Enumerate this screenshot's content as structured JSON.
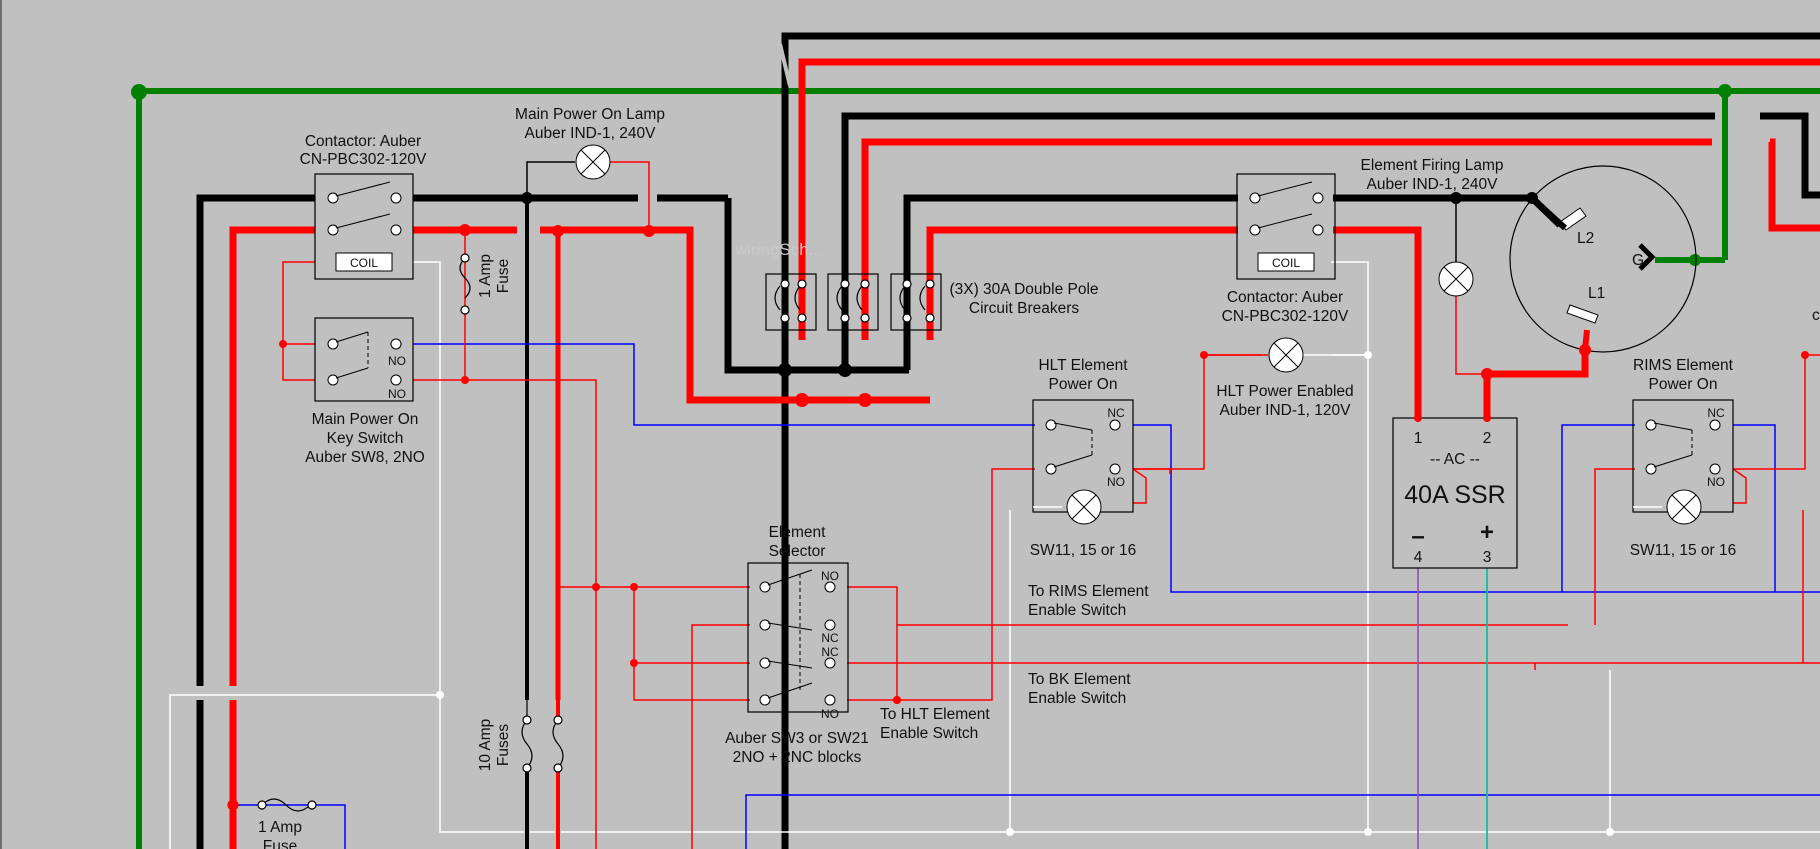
{
  "diagram": {
    "colors": {
      "background": "#c0c0c0",
      "line1": "#000000",
      "line2": "#ff0000",
      "ground": "#008000",
      "signal_blue": "#0000ff",
      "signal_red": "#ff0000",
      "neutral_white": "#ffffff",
      "ssr_dc_minus": "#9b59b6",
      "ssr_dc_plus": "#1abc9c"
    },
    "watermark": "wiringSch...",
    "labels": {
      "contactor1": [
        "Contactor:  Auber",
        "CN-PBC302-120V"
      ],
      "main_lamp": [
        "Main Power On Lamp",
        "Auber IND-1, 240V"
      ],
      "key_switch": [
        "Main Power On",
        "Key Switch",
        "Auber SW8, 2NO"
      ],
      "fuse_1amp_top": [
        "1 Amp",
        "Fuse"
      ],
      "breakers": [
        "(3X) 30A Double Pole",
        "Circuit Breakers"
      ],
      "firing_lamp": [
        "Element Firing Lamp",
        "Auber IND-1, 240V"
      ],
      "contactor2": [
        "Contactor:  Auber",
        "CN-PBC302-120V"
      ],
      "hlt_power_enabled": [
        "HLT Power Enabled",
        "Auber IND-1, 120V"
      ],
      "hlt_element": [
        "HLT Element",
        "Power On"
      ],
      "sw_hlt": "SW11, 15 or 16",
      "rims_element": [
        "RIMS Element",
        "Power On"
      ],
      "sw_rims": "SW11, 15 or 16",
      "ssr": {
        "pin1": "1",
        "pin2": "2",
        "ac": "-- AC --",
        "title": "40A SSR",
        "minus": "–",
        "plus": "+",
        "pin4": "4",
        "pin3": "3"
      },
      "to_rims": [
        "To RIMS Element",
        "Enable Switch"
      ],
      "to_bk": [
        "To BK Element",
        "Enable Switch"
      ],
      "element_selector": [
        "Element",
        "Selector"
      ],
      "selector_model": [
        "Auber SW3 or SW21",
        "2NO + 2NC blocks"
      ],
      "to_hlt": [
        "To HLT Element",
        "Enable Switch"
      ],
      "fuses_10amp": [
        "10 Amp",
        "Fuses"
      ],
      "fuse_1amp_bottom": [
        "1 Amp",
        "Fuse"
      ],
      "coil": "COIL",
      "no": "NO",
      "nc": "NC",
      "l1": "L1",
      "l2": "L2",
      "g": "G",
      "right_cut": "c"
    }
  }
}
